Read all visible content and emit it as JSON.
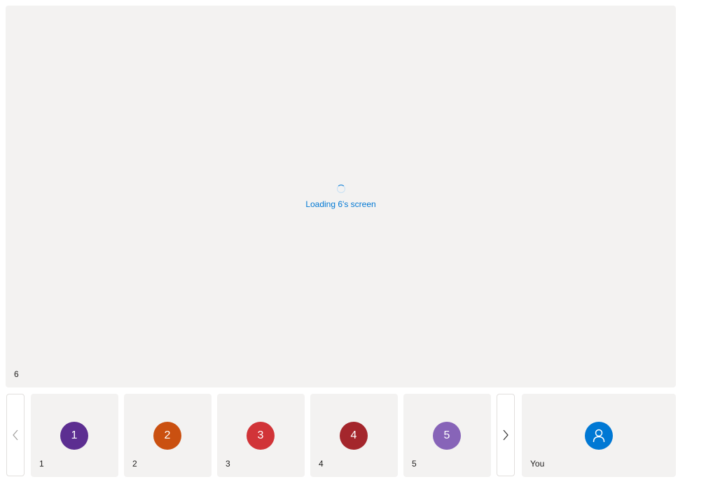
{
  "main_stage": {
    "loading_text": "Loading 6's screen",
    "participant_name": "6"
  },
  "gallery": {
    "prev_icon": "chevron-left-icon",
    "next_icon": "chevron-right-icon",
    "participants": [
      {
        "initial": "1",
        "name": "1",
        "color": "#5c2e91"
      },
      {
        "initial": "2",
        "name": "2",
        "color": "#ca5010"
      },
      {
        "initial": "3",
        "name": "3",
        "color": "#d13438"
      },
      {
        "initial": "4",
        "name": "4",
        "color": "#a4262c"
      },
      {
        "initial": "5",
        "name": "5",
        "color": "#8764b8"
      }
    ],
    "self": {
      "name": "You",
      "icon": "person-icon",
      "color": "#0078d4"
    }
  }
}
